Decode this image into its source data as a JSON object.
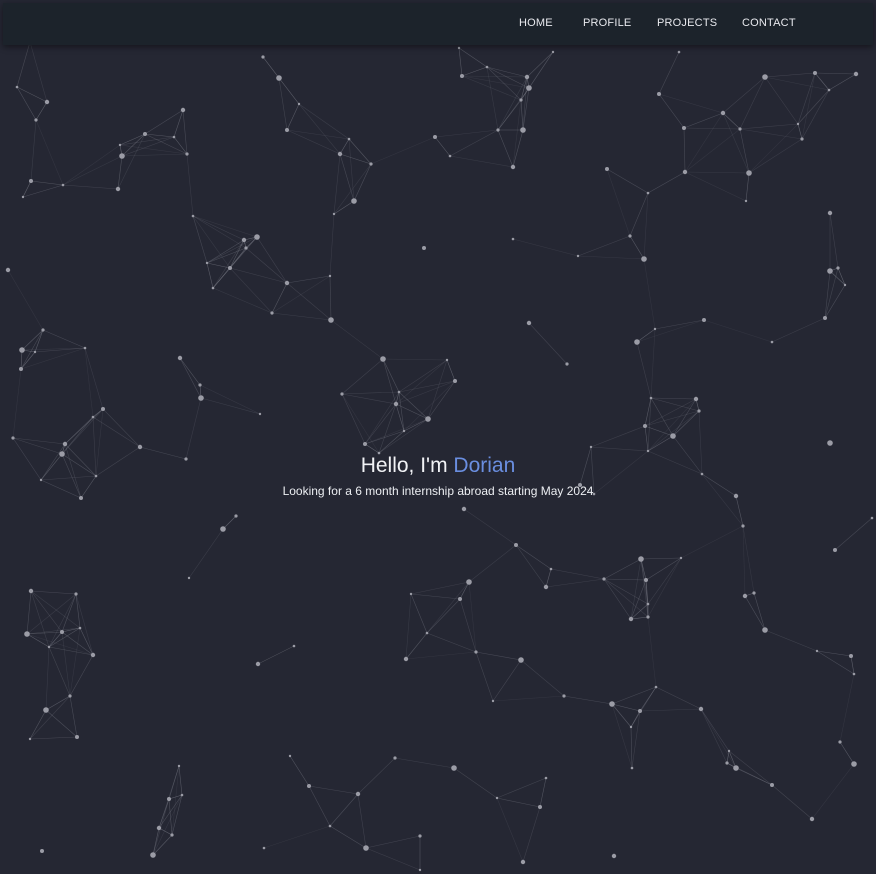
{
  "nav": {
    "items": [
      {
        "label": "HOME"
      },
      {
        "label": "PROFILE"
      },
      {
        "label": "PROJECTS"
      },
      {
        "label": "CONTACT"
      }
    ]
  },
  "hero": {
    "greeting": "Hello, I'm",
    "name": "Dorian",
    "tagline": "Looking for a 6 month internship abroad starting May 2024"
  },
  "colors": {
    "background": "#252733",
    "navbar": "#1c232b",
    "accent": "#6a8ee0",
    "particle": "#9b9ca6"
  }
}
